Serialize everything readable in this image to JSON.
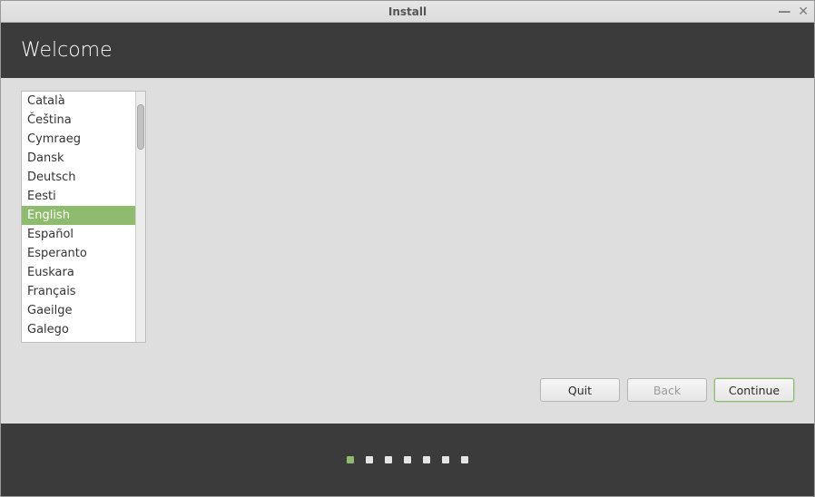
{
  "window": {
    "title": "Install"
  },
  "header": {
    "title": "Welcome"
  },
  "languages": {
    "selected_index": 6,
    "items": [
      "Català",
      "Čeština",
      "Cymraeg",
      "Dansk",
      "Deutsch",
      "Eesti",
      "English",
      "Español",
      "Esperanto",
      "Euskara",
      "Français",
      "Gaeilge",
      "Galego"
    ]
  },
  "buttons": {
    "quit": "Quit",
    "back": "Back",
    "continue": "Continue"
  },
  "progress": {
    "total": 7,
    "current": 0
  }
}
